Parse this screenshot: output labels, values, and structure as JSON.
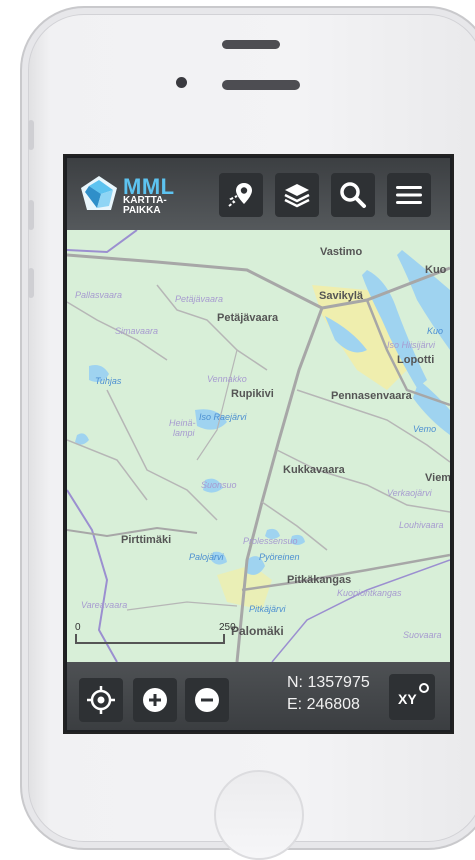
{
  "logo": {
    "title": "MML",
    "line1": "KARTTA-",
    "line2": "PAIKKA"
  },
  "toolbar": {
    "route_icon": "route-pin-icon",
    "layers_icon": "layers-icon",
    "search_icon": "search-icon",
    "menu_icon": "hamburger-menu-icon"
  },
  "map": {
    "labels": [
      {
        "text": "Vastimo",
        "kind": "town"
      },
      {
        "text": "Kuo",
        "kind": "town"
      },
      {
        "text": "Savikylä",
        "kind": "town"
      },
      {
        "text": "Pallasvaara",
        "kind": "minor"
      },
      {
        "text": "Petäjävaara",
        "kind": "minor"
      },
      {
        "text": "Petäjävaara",
        "kind": "town"
      },
      {
        "text": "Kuo",
        "kind": "water"
      },
      {
        "text": "Simavaara",
        "kind": "minor"
      },
      {
        "text": "Iso Hiisijärvi",
        "kind": "minor"
      },
      {
        "text": "Lopotti",
        "kind": "town"
      },
      {
        "text": "Tuhjas",
        "kind": "water"
      },
      {
        "text": "Vennakko",
        "kind": "minor"
      },
      {
        "text": "Rupikivi",
        "kind": "town"
      },
      {
        "text": "Pennasenvaara",
        "kind": "town"
      },
      {
        "text": "Heinä-",
        "kind": "minor"
      },
      {
        "text": "lampi",
        "kind": "minor"
      },
      {
        "text": "Iso Raejärvi",
        "kind": "water"
      },
      {
        "text": "Vemo",
        "kind": "water"
      },
      {
        "text": "Kukkavaara",
        "kind": "town"
      },
      {
        "text": "Suonsuo",
        "kind": "minor"
      },
      {
        "text": "Viem",
        "kind": "town"
      },
      {
        "text": "Verkaojärvi",
        "kind": "minor"
      },
      {
        "text": "Louhivaara",
        "kind": "minor"
      },
      {
        "text": "Pirttimäki",
        "kind": "town"
      },
      {
        "text": "Prolessensuo",
        "kind": "minor"
      },
      {
        "text": "Palojärvi",
        "kind": "water"
      },
      {
        "text": "Pyöreinen",
        "kind": "water"
      },
      {
        "text": "Pitkäkangas",
        "kind": "town"
      },
      {
        "text": "Kuopiontkangas",
        "kind": "minor"
      },
      {
        "text": "Vareavaara",
        "kind": "minor"
      },
      {
        "text": "Pitkäjärvi",
        "kind": "water"
      },
      {
        "text": "Palomäki",
        "kind": "town"
      },
      {
        "text": "Suovaara",
        "kind": "minor"
      }
    ],
    "scale": {
      "start": "0",
      "end": "250"
    }
  },
  "bottom": {
    "locate_icon": "locate-crosshair-icon",
    "zoom_in_icon": "zoom-in-icon",
    "zoom_out_icon": "zoom-out-icon",
    "north": "N: 1357975",
    "east": "E: 246808",
    "xy_label": "XY"
  },
  "colors": {
    "land": "#d8efd8",
    "water": "#9fd3f0",
    "road": "#a7a7a7",
    "urban": "#f7eea0",
    "border": "#9b8fd0",
    "logo_accent": "#5dc3f0"
  }
}
